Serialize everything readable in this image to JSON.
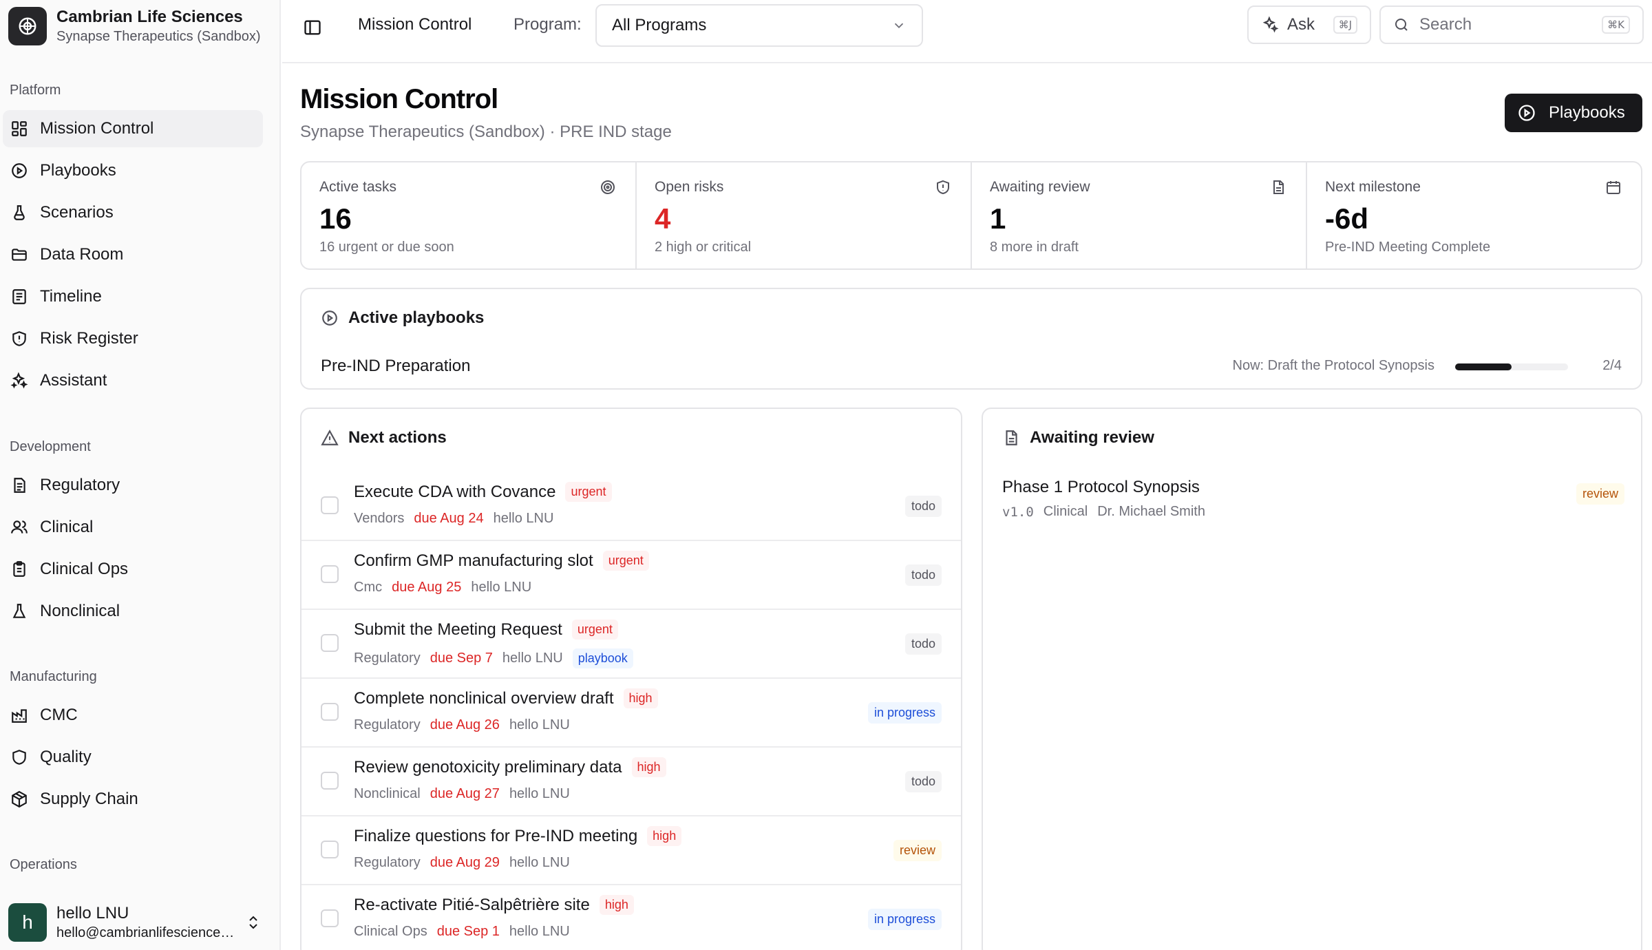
{
  "org": {
    "name": "Cambrian Life Sciences",
    "workspace": "Synapse Therapeutics (Sandbox)"
  },
  "sidebar": {
    "groups": [
      {
        "label": "Platform",
        "items": [
          {
            "label": "Mission Control",
            "icon": "grid-icon",
            "active": true
          },
          {
            "label": "Playbooks",
            "icon": "play-circle-icon"
          },
          {
            "label": "Scenarios",
            "icon": "flask-icon"
          },
          {
            "label": "Data Room",
            "icon": "folder-icon"
          },
          {
            "label": "Timeline",
            "icon": "list-icon"
          },
          {
            "label": "Risk Register",
            "icon": "shield-alert-icon"
          },
          {
            "label": "Assistant",
            "icon": "sparkles-icon"
          }
        ]
      },
      {
        "label": "Development",
        "items": [
          {
            "label": "Regulatory",
            "icon": "file-icon"
          },
          {
            "label": "Clinical",
            "icon": "users-icon"
          },
          {
            "label": "Clinical Ops",
            "icon": "clipboard-icon"
          },
          {
            "label": "Nonclinical",
            "icon": "beaker-icon"
          }
        ]
      },
      {
        "label": "Manufacturing",
        "items": [
          {
            "label": "CMC",
            "icon": "factory-icon"
          },
          {
            "label": "Quality",
            "icon": "shield-icon"
          },
          {
            "label": "Supply Chain",
            "icon": "package-icon"
          }
        ]
      },
      {
        "label": "Operations",
        "items": []
      }
    ]
  },
  "user": {
    "initial": "h",
    "name": "hello LNU",
    "email": "hello@cambrianlifesciences.com"
  },
  "topbar": {
    "breadcrumb": "Mission Control",
    "program_label": "Program:",
    "program_value": "All Programs",
    "ask_label": "Ask",
    "ask_shortcut": "⌘J",
    "search_placeholder": "Search",
    "search_shortcut": "⌘K"
  },
  "page": {
    "title": "Mission Control",
    "subtitle": "Synapse Therapeutics (Sandbox) · PRE IND stage",
    "playbooks_button": "Playbooks"
  },
  "stats": [
    {
      "label": "Active tasks",
      "value": "16",
      "note": "16 urgent or due soon",
      "icon": "target-icon",
      "alert": false
    },
    {
      "label": "Open risks",
      "value": "4",
      "note": "2 high or critical",
      "icon": "shield-alert-icon",
      "alert": true
    },
    {
      "label": "Awaiting review",
      "value": "1",
      "note": "8 more in draft",
      "icon": "file-text-icon",
      "alert": false
    },
    {
      "label": "Next milestone",
      "value": "-6d",
      "note": "Pre-IND Meeting Complete",
      "icon": "calendar-icon",
      "alert": false
    }
  ],
  "active_playbooks": {
    "title": "Active playbooks",
    "items": [
      {
        "name": "Pre-IND Preparation",
        "now": "Now: Draft the Protocol Synopsis",
        "progress": 0.5,
        "count": "2/4"
      }
    ]
  },
  "next_actions": {
    "title": "Next actions",
    "tasks": [
      {
        "title": "Execute CDA with Covance",
        "priority": "urgent",
        "area": "Vendors",
        "due": "due Aug 24",
        "owner": "hello LNU",
        "tag": "",
        "status": "todo"
      },
      {
        "title": "Confirm GMP manufacturing slot",
        "priority": "urgent",
        "area": "Cmc",
        "due": "due Aug 25",
        "owner": "hello LNU",
        "tag": "",
        "status": "todo"
      },
      {
        "title": "Submit the Meeting Request",
        "priority": "urgent",
        "area": "Regulatory",
        "due": "due Sep 7",
        "owner": "hello LNU",
        "tag": "playbook",
        "status": "todo"
      },
      {
        "title": "Complete nonclinical overview draft",
        "priority": "high",
        "area": "Regulatory",
        "due": "due Aug 26",
        "owner": "hello LNU",
        "tag": "",
        "status": "in progress"
      },
      {
        "title": "Review genotoxicity preliminary data",
        "priority": "high",
        "area": "Nonclinical",
        "due": "due Aug 27",
        "owner": "hello LNU",
        "tag": "",
        "status": "todo"
      },
      {
        "title": "Finalize questions for Pre-IND meeting",
        "priority": "high",
        "area": "Regulatory",
        "due": "due Aug 29",
        "owner": "hello LNU",
        "tag": "",
        "status": "review"
      },
      {
        "title": "Re-activate Pitié-Salpêtrière site",
        "priority": "high",
        "area": "Clinical Ops",
        "due": "due Sep 1",
        "owner": "hello LNU",
        "tag": "",
        "status": "in progress"
      }
    ]
  },
  "awaiting_review": {
    "title": "Awaiting review",
    "items": [
      {
        "title": "Phase 1 Protocol Synopsis",
        "version": "v1.0",
        "area": "Clinical",
        "owner": "Dr. Michael Smith",
        "status": "review"
      }
    ]
  },
  "colors": {
    "alert": "#dc2626",
    "primary": "#18181b",
    "avatar": "#1b4d3e"
  }
}
